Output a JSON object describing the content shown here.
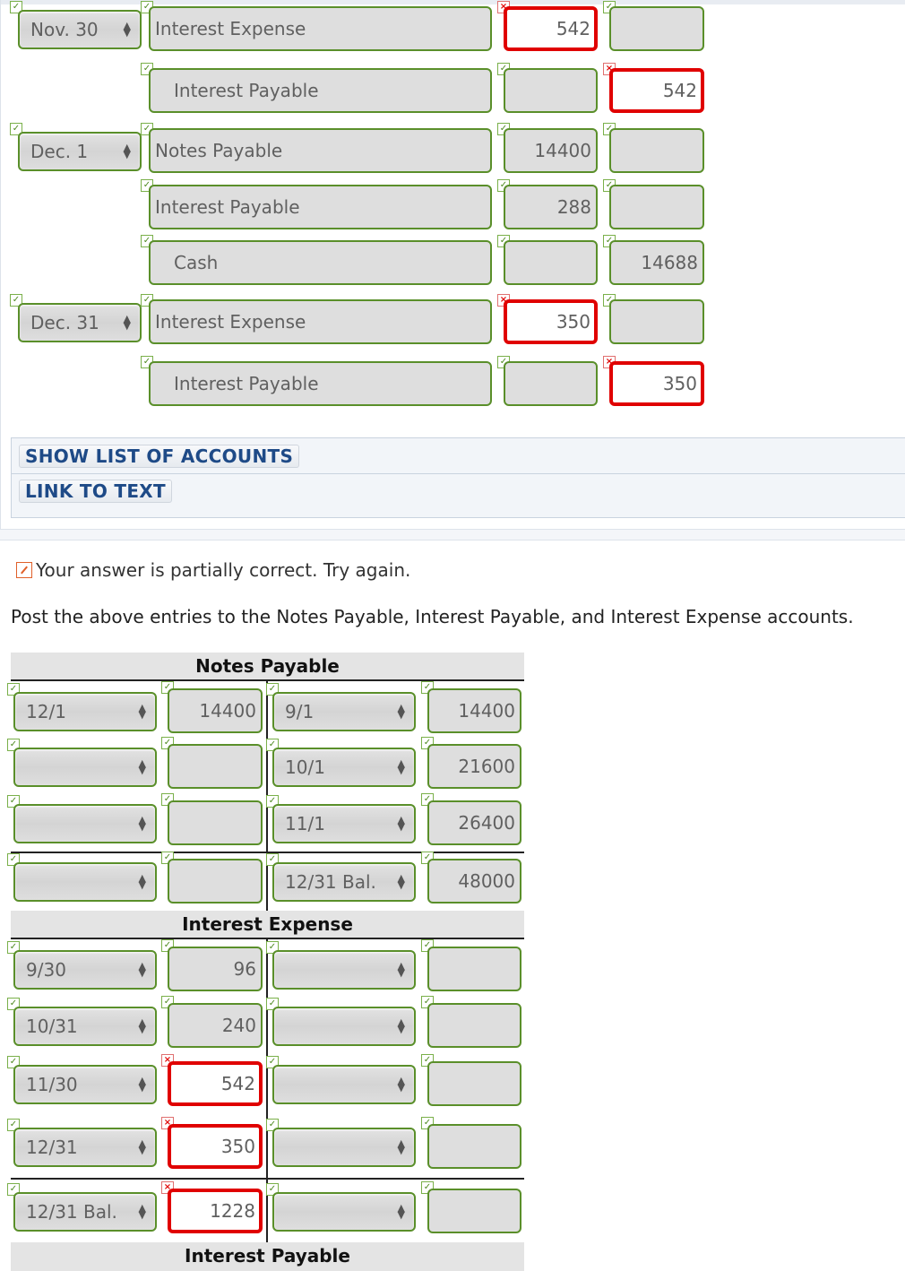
{
  "journal": {
    "rows": [
      {
        "date": "Nov. 30",
        "account": "Interest Expense",
        "indent": false,
        "debit": "542",
        "credit": "",
        "debit_status": "incorrect",
        "credit_status": "correct"
      },
      {
        "date": null,
        "account": "Interest Payable",
        "indent": true,
        "debit": "",
        "credit": "542",
        "debit_status": "correct",
        "credit_status": "incorrect"
      },
      {
        "date": "Dec. 1",
        "account": "Notes Payable",
        "indent": false,
        "debit": "14400",
        "credit": "",
        "debit_status": "correct",
        "credit_status": "correct"
      },
      {
        "date": null,
        "account": "Interest Payable",
        "indent": false,
        "debit": "288",
        "credit": "",
        "debit_status": "correct",
        "credit_status": "correct"
      },
      {
        "date": null,
        "account": "Cash",
        "indent": true,
        "debit": "",
        "credit": "14688",
        "debit_status": "correct",
        "credit_status": "correct"
      },
      {
        "date": "Dec. 31",
        "account": "Interest Expense",
        "indent": false,
        "debit": "350",
        "credit": "",
        "debit_status": "incorrect",
        "credit_status": "correct"
      },
      {
        "date": null,
        "account": "Interest Payable",
        "indent": true,
        "debit": "",
        "credit": "350",
        "debit_status": "correct",
        "credit_status": "incorrect"
      }
    ]
  },
  "buttons": {
    "show_list": "SHOW LIST OF ACCOUNTS",
    "link_text": "LINK TO TEXT"
  },
  "feedback": {
    "message": "Your answer is partially correct.  Try again.",
    "instruction": "Post the above entries to the Notes Payable, Interest Payable, and Interest Expense accounts."
  },
  "taccounts": [
    {
      "title": "Notes Payable",
      "rows": [
        {
          "ldate": "12/1",
          "lamt": "14400",
          "lstatus": "correct",
          "rdate": "9/1",
          "ramt": "14400",
          "rstatus": "correct"
        },
        {
          "ldate": "",
          "lamt": "",
          "lstatus": "correct",
          "rdate": "10/1",
          "ramt": "21600",
          "rstatus": "correct"
        },
        {
          "ldate": "",
          "lamt": "",
          "lstatus": "correct",
          "rdate": "11/1",
          "ramt": "26400",
          "rstatus": "correct"
        }
      ],
      "balance": {
        "ldate": "",
        "lamt": "",
        "lstatus": "correct",
        "rdate": "12/31 Bal.",
        "ramt": "48000",
        "rstatus": "correct"
      }
    },
    {
      "title": "Interest Expense",
      "rows": [
        {
          "ldate": "9/30",
          "lamt": "96",
          "lstatus": "correct",
          "rdate": "",
          "ramt": "",
          "rstatus": "correct"
        },
        {
          "ldate": "10/31",
          "lamt": "240",
          "lstatus": "correct",
          "rdate": "",
          "ramt": "",
          "rstatus": "correct"
        },
        {
          "ldate": "11/30",
          "lamt": "542",
          "lstatus": "incorrect",
          "rdate": "",
          "ramt": "",
          "rstatus": "correct"
        },
        {
          "ldate": "12/31",
          "lamt": "350",
          "lstatus": "incorrect",
          "rdate": "",
          "ramt": "",
          "rstatus": "correct"
        }
      ],
      "balance": {
        "ldate": "12/31 Bal.",
        "lamt": "1228",
        "lstatus": "incorrect",
        "rdate": "",
        "ramt": "",
        "rstatus": "correct"
      }
    },
    {
      "title": "Interest Payable"
    }
  ],
  "colors": {
    "correct_border": "#5a8f2a",
    "incorrect_border": "#e00000",
    "link_blue": "#1e4a87"
  }
}
